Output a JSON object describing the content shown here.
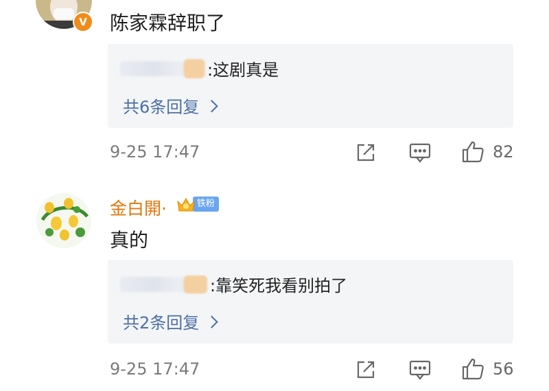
{
  "comments": [
    {
      "username": "",
      "text": "陈家霖辞职了",
      "reply_preview": ":这剧真是",
      "reply_count": "共6条回复",
      "timestamp": "9-25 17:47",
      "likes": "82"
    },
    {
      "username": "金白開·",
      "badge": "铁粉",
      "text": "真的",
      "reply_preview": ":靠笑死我看别拍了",
      "reply_count": "共2条回复",
      "timestamp": "9-25 17:47",
      "likes": "56"
    }
  ],
  "icons": {
    "share": "share-icon",
    "comment": "comment-icon",
    "like": "thumbs-up-icon",
    "verified": "verified-badge-icon",
    "fan_crown": "crown-icon"
  },
  "colors": {
    "username": "#e2770b",
    "reply_link": "#4a6fa5",
    "reply_bg": "#f4f5f7",
    "verified": "#f08c1a",
    "fan_badge": "#6aa6f0"
  }
}
